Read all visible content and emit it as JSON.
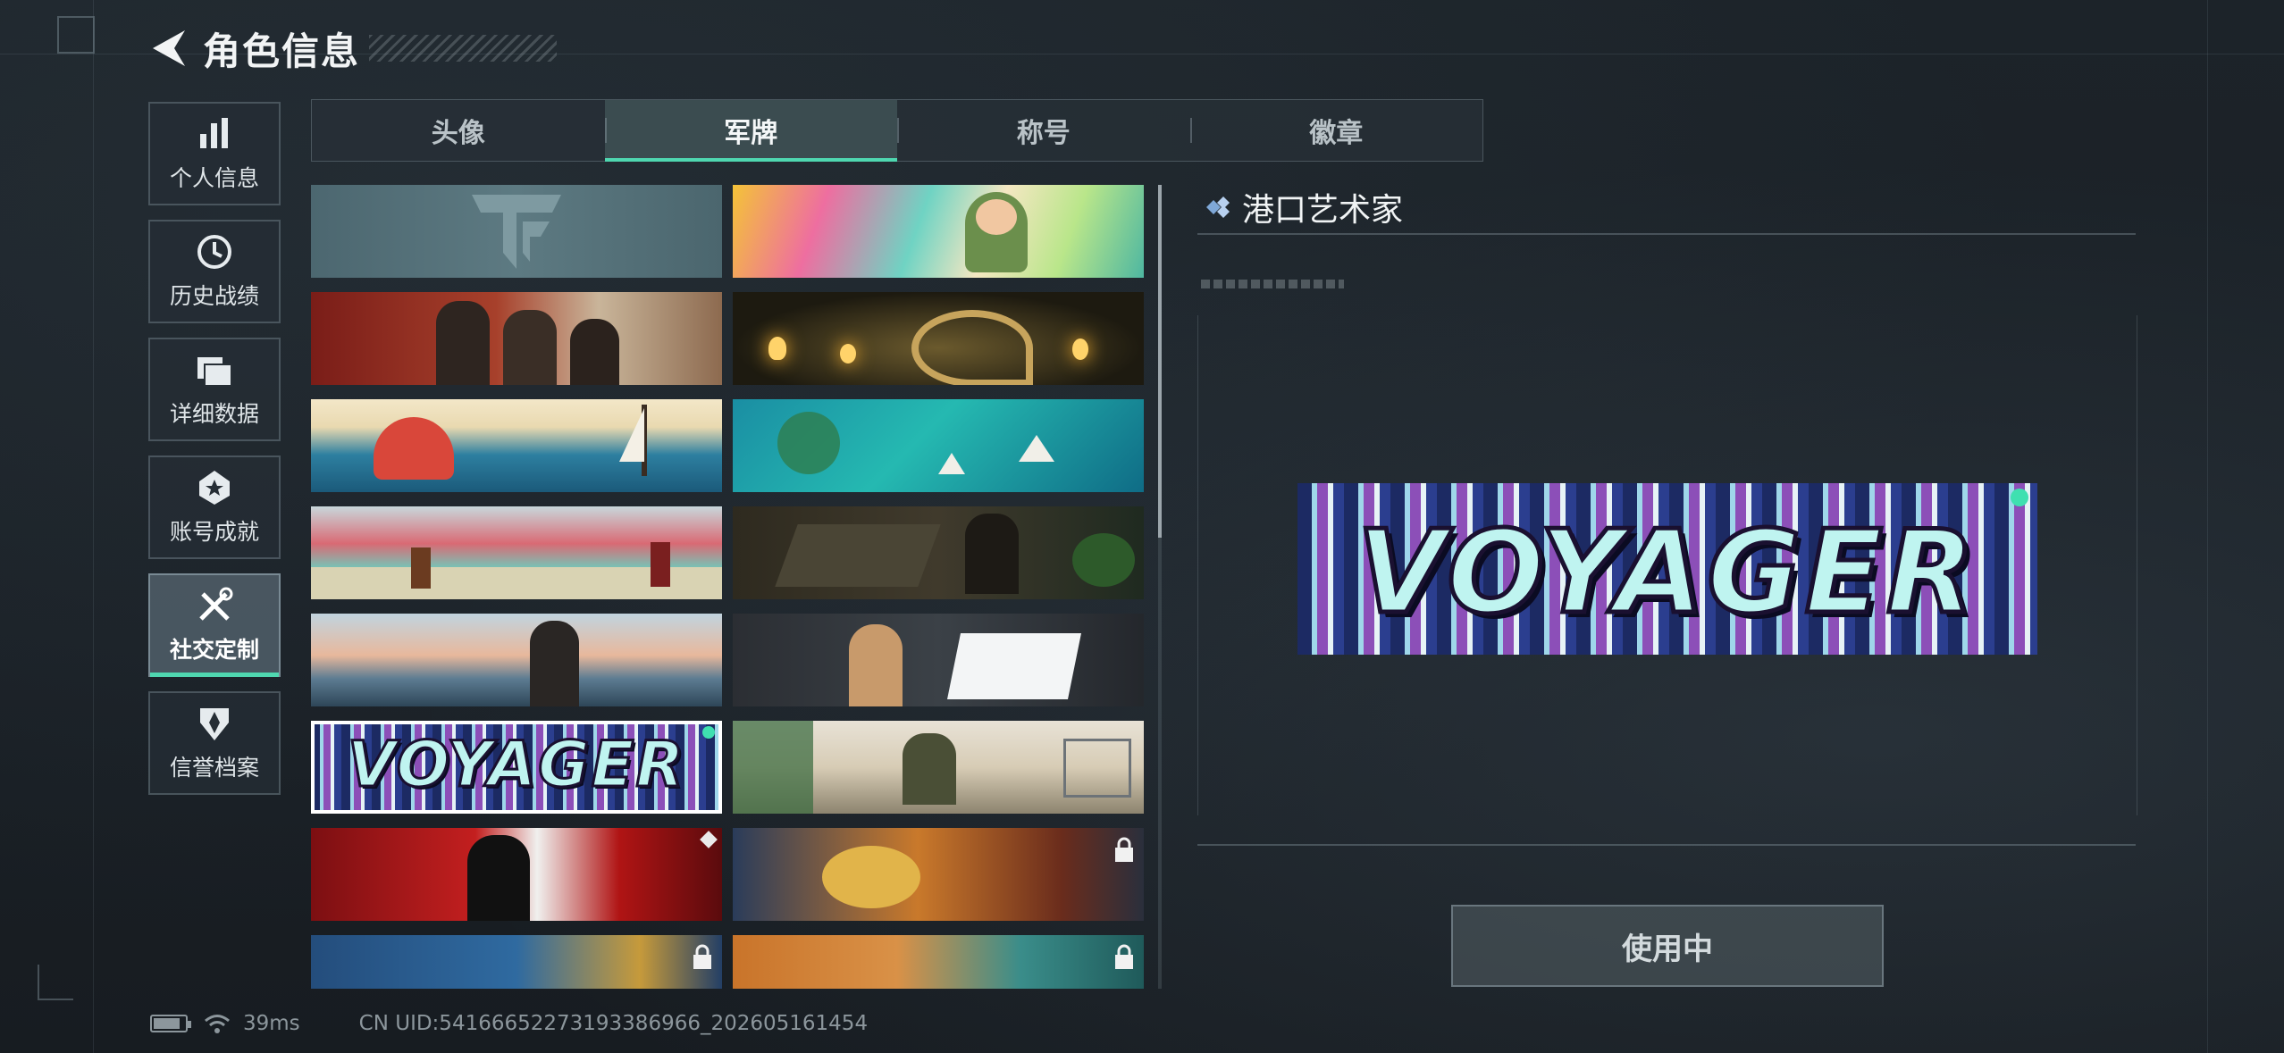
{
  "header": {
    "title": "角色信息"
  },
  "sidebar": {
    "items": [
      {
        "label": "个人信息",
        "icon": "bar-chart-icon",
        "active": false
      },
      {
        "label": "历史战绩",
        "icon": "clock-history-icon",
        "active": false
      },
      {
        "label": "详细数据",
        "icon": "folder-icon",
        "active": false
      },
      {
        "label": "账号成就",
        "icon": "achievement-icon",
        "active": false
      },
      {
        "label": "社交定制",
        "icon": "tools-icon",
        "active": true
      },
      {
        "label": "信誉档案",
        "icon": "shield-icon",
        "active": false
      }
    ]
  },
  "tabs": [
    {
      "label": "头像",
      "active": false
    },
    {
      "label": "军牌",
      "active": true
    },
    {
      "label": "称号",
      "active": false
    },
    {
      "label": "徽章",
      "active": false
    }
  ],
  "cards": [
    {
      "theme": "default-emblem",
      "locked": false,
      "selected": false,
      "text": ""
    },
    {
      "theme": "anime-headphones",
      "locked": false,
      "selected": false,
      "text": ""
    },
    {
      "theme": "soldiers-red",
      "locked": false,
      "selected": false,
      "text": ""
    },
    {
      "theme": "lanterns-swan",
      "locked": false,
      "selected": false,
      "text": ""
    },
    {
      "theme": "octopus-wave",
      "locked": false,
      "selected": false,
      "text": ""
    },
    {
      "theme": "boats-lagoon",
      "locked": false,
      "selected": false,
      "text": ""
    },
    {
      "theme": "container-yard",
      "locked": false,
      "selected": false,
      "text": ""
    },
    {
      "theme": "map-table-man",
      "locked": false,
      "selected": false,
      "text": ""
    },
    {
      "theme": "seaside-woman",
      "locked": false,
      "selected": false,
      "text": ""
    },
    {
      "theme": "laptop-woman",
      "locked": false,
      "selected": false,
      "text": ""
    },
    {
      "theme": "voyager",
      "locked": false,
      "selected": true,
      "text": "VOYAGER"
    },
    {
      "theme": "office-soldier",
      "locked": false,
      "selected": false,
      "text": ""
    },
    {
      "theme": "red-burst-man",
      "locked": false,
      "selected": false,
      "text": ""
    },
    {
      "theme": "explosion-orange",
      "locked": true,
      "selected": false,
      "text": ""
    },
    {
      "theme": "blue-yellow",
      "locked": true,
      "selected": false,
      "text": ""
    },
    {
      "theme": "orange-teal",
      "locked": true,
      "selected": false,
      "text": ""
    }
  ],
  "detail": {
    "name": "港口艺术家",
    "preview_text": "VOYAGER",
    "action_label": "使用中"
  },
  "status": {
    "battery_level": 0.85,
    "ping": "39ms",
    "uid": "CN UID:5416665227319338696​6_202605161454"
  },
  "colors": {
    "accent": "#4fd7b0",
    "background": "#1b2127",
    "panel": "#262e35"
  }
}
